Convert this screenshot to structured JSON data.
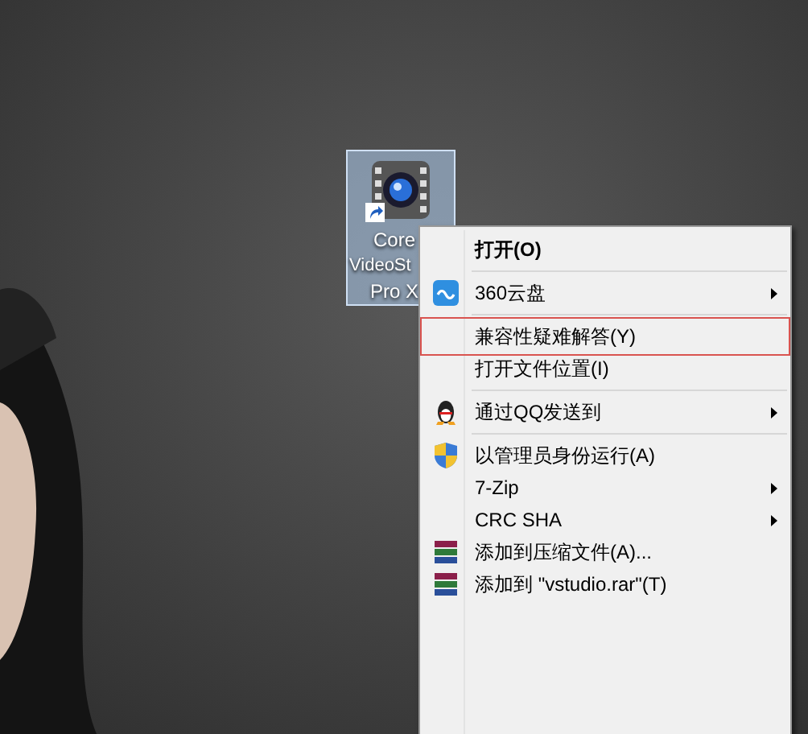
{
  "desktop_icon": {
    "label_lines": [
      "Core",
      "VideoSt",
      "Pro X"
    ],
    "selected": true
  },
  "context_menu": {
    "items": [
      {
        "kind": "plain",
        "label": "打开(O)",
        "bold": true,
        "submenu": false,
        "highlighted": false
      },
      {
        "kind": "separator"
      },
      {
        "kind": "cloud",
        "label": "360云盘",
        "bold": false,
        "submenu": true,
        "highlighted": false
      },
      {
        "kind": "separator"
      },
      {
        "kind": "plain",
        "label": "兼容性疑难解答(Y)",
        "bold": false,
        "submenu": false,
        "highlighted": true
      },
      {
        "kind": "plain",
        "label": "打开文件位置(I)",
        "bold": false,
        "submenu": false,
        "highlighted": false
      },
      {
        "kind": "separator"
      },
      {
        "kind": "qq",
        "label": "通过QQ发送到",
        "bold": false,
        "submenu": true,
        "highlighted": false
      },
      {
        "kind": "separator"
      },
      {
        "kind": "shield",
        "label": "以管理员身份运行(A)",
        "bold": false,
        "submenu": false,
        "highlighted": false
      },
      {
        "kind": "plain",
        "label": "7-Zip",
        "bold": false,
        "submenu": true,
        "highlighted": false
      },
      {
        "kind": "plain",
        "label": "CRC SHA",
        "bold": false,
        "submenu": true,
        "highlighted": false
      },
      {
        "kind": "archive",
        "label": "添加到压缩文件(A)...",
        "bold": false,
        "submenu": false,
        "highlighted": false
      },
      {
        "kind": "archive",
        "label": "添加到 \"vstudio.rar\"(T)",
        "bold": false,
        "submenu": false,
        "highlighted": false
      }
    ]
  }
}
